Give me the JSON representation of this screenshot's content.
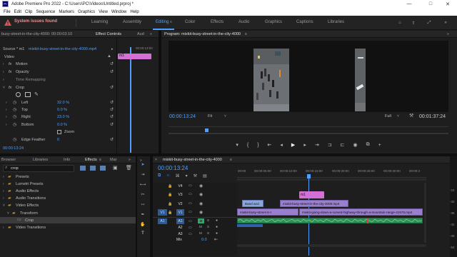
{
  "window": {
    "title": "Adobe Premiere Pro 2022 - C:\\Users\\PC\\Videos\\Untitled.prproj *",
    "logo": "Pr",
    "minimize": "—",
    "maximize": "□",
    "close": "✕"
  },
  "menu": [
    "File",
    "Edit",
    "Clip",
    "Sequence",
    "Markers",
    "Graphics",
    "View",
    "Window",
    "Help"
  ],
  "workspace": {
    "warning": "System issues found",
    "tabs": [
      "Learning",
      "Assembly",
      "Editing",
      "Color",
      "Effects",
      "Audio",
      "Graphics",
      "Captions",
      "Libraries"
    ],
    "active": "Editing"
  },
  "effect_controls": {
    "tabs": [
      "busy-street-in-the-city-4000: 00:00:03:10",
      "Effect Controls",
      "Aud"
    ],
    "source_line": "Source * m1",
    "source_clip": "mixkit-busy-street-in-the-city-4000.mp4",
    "mini_time": "00:00:13:00",
    "clip_label": "m1",
    "section": "Video",
    "motion": "Motion",
    "opacity": "Opacity",
    "time_remap": "Time Remapping",
    "crop": "Crop",
    "left_label": "Left",
    "left_value": "32.0 %",
    "top_label": "Top",
    "top_value": "0.0 %",
    "right_label": "Right",
    "right_value": "23.0 %",
    "bottom_label": "Bottom",
    "bottom_value": "0.0 %",
    "zoom_label": "Zoom",
    "edge_label": "Edge Feather",
    "edge_value": "0",
    "bottom_time": "00:00:13:24",
    "fx": "fx"
  },
  "program": {
    "title": "Program: mixkit-busy-street-in-the-city-4000",
    "timecode": "00:00:13:24",
    "fit": "Fit",
    "quality": "Full",
    "duration": "00:01:37:24"
  },
  "effects_panel": {
    "tabs": [
      "Browser",
      "Libraries",
      "Info",
      "Effects",
      "Mar"
    ],
    "search": "crop",
    "tree": [
      "Presets",
      "Lumetri Presets",
      "Audio Effects",
      "Audio Transitions",
      "Video Effects",
      "Transform",
      "Crop",
      "Video Transitions"
    ]
  },
  "timeline": {
    "tab": "mixkit-busy-street-in-the-city-4000",
    "timecode": "00:00:13:24",
    "ruler": [
      "00:00",
      "00:00:05:00",
      "00:00:10:00",
      "00:00:15:00",
      "00:00:20:00",
      "00:00:25:00",
      "00:00:30:00",
      "00:00:3"
    ],
    "tracks": {
      "v4": "V4",
      "v3": "V3",
      "v2": "V2",
      "v1": "V1",
      "v1_src": "V1",
      "a1": "A1",
      "a1_src": "A1",
      "a2": "A2",
      "a3": "A3",
      "mix": "Mix",
      "mix_val": "0.0"
    },
    "clips": {
      "m1": "m1",
      "band": "Band and",
      "v2_clip": "mixkit-busy-street-in-the-city-4000.mp4",
      "v1a": "mixkit-busy-street-in-t",
      "v1b": "mixkit-going-down-a-curved-highway-through-a-mountain-range-41576.mp4"
    },
    "meter_scale": [
      "-24",
      "-30",
      "-36",
      "-42",
      "-48",
      "-54"
    ]
  }
}
